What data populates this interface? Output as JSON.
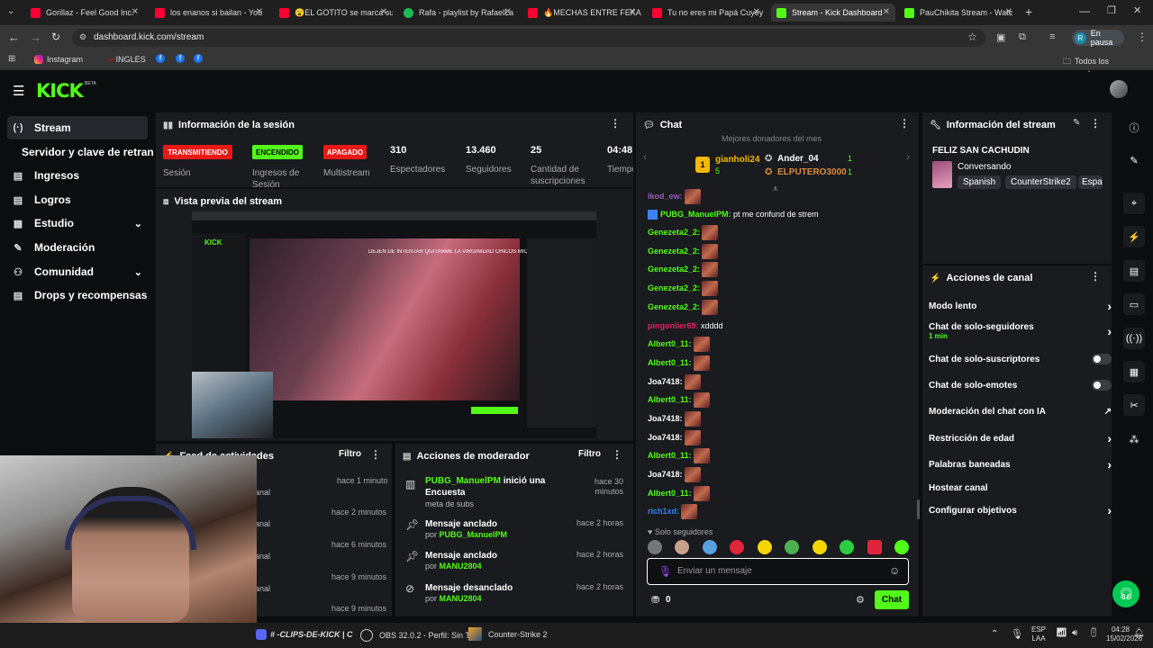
{
  "browser": {
    "tabs": [
      {
        "label": "Gorillaz - Feel Good Inc.",
        "color": "#ff0033"
      },
      {
        "label": "los enanos si bailan - You",
        "color": "#ff0033"
      },
      {
        "label": "😮EL GOTITO se marca su",
        "color": "#ff0033"
      },
      {
        "label": "Rafa - playlist by RafaelLa",
        "color": "#1db954"
      },
      {
        "label": "🔥MECHAS ENTRE FEKA (",
        "color": "#ff0033"
      },
      {
        "label": "Tu no eres mi Papá Cuyey",
        "color": "#ff0033"
      },
      {
        "label": "Stream - Kick Dashboard",
        "color": "#53fc18"
      },
      {
        "label": "PauChikita Stream - Watc",
        "color": "#53fc18"
      }
    ],
    "url": "dashboard.kick.com/stream",
    "profile_label": "En pausa",
    "profile_initial": "R",
    "bookmarks": [
      "Instagram",
      "INGLES"
    ],
    "all_bookmarks": "Todos los marcadores"
  },
  "brand": {
    "logo": "KICK",
    "beta": "BETA",
    "accent": "#53fc18"
  },
  "sidebar": {
    "items": [
      {
        "label": "Stream",
        "icon": "(·)"
      },
      {
        "label": "Servidor y clave de retransmisión",
        "icon": ""
      },
      {
        "label": "Ingresos",
        "icon": "▤"
      },
      {
        "label": "Logros",
        "icon": "▤"
      },
      {
        "label": "Estudio",
        "icon": "▦"
      },
      {
        "label": "Moderación",
        "icon": "🔧"
      },
      {
        "label": "Comunidad",
        "icon": "👥"
      },
      {
        "label": "Drops y recompensas",
        "icon": "▤"
      }
    ]
  },
  "session": {
    "title": "Información de la sesión",
    "badges": {
      "session": "TRANSMITIENDO",
      "ingress": "ENCENDIDO",
      "multistream": "APAGADO"
    },
    "labels": {
      "session": "Sesión",
      "ingress": "Ingresos de Sesión",
      "multistream": "Multistream"
    },
    "stats": [
      {
        "value": "310",
        "label": "Espectadores"
      },
      {
        "value": "13.460",
        "label": "Seguidores"
      },
      {
        "value": "25",
        "label": "Cantidad de suscripciones"
      },
      {
        "value": "04:48:",
        "label": "Tiempo en vivo"
      }
    ]
  },
  "preview": {
    "title": "Vista previa del stream",
    "overlay_text": "DEJEN DE INTENTAR QUITARME LA VIRGINIDAD CHICOS MIO"
  },
  "feed": {
    "title": "Feed de actividades",
    "filter": "Filtro",
    "times": [
      "hace 1 minuto",
      "hace 2 minutos",
      "hace 6 minutos",
      "hace 9 minutos",
      "hace 9 minutos"
    ],
    "snippets": [
      "anal",
      "anal",
      "anal",
      "anal",
      "anal"
    ]
  },
  "modactions": {
    "title": "Acciones de moderador",
    "filter": "Filtro",
    "items": [
      {
        "user": "PUBG_ManuelPM",
        "action": "inició una Encuesta",
        "sub": "meta de subs",
        "time": "hace 30 minutos"
      },
      {
        "title": "Mensaje anclado",
        "by": "por",
        "user": "PUBG_ManuelPM",
        "time": "hace 2 horas"
      },
      {
        "title": "Mensaje anclado",
        "by": "por",
        "user": "MANU2804",
        "time": "hace 2 horas"
      },
      {
        "title": "Mensaje desanclado",
        "by": "por",
        "user": "MANU2804",
        "time": "hace 2 horas"
      }
    ]
  },
  "chat": {
    "title": "Chat",
    "donors_title": "Mejores donadores del mes",
    "donors": [
      {
        "name": "gianholi24",
        "count": "5"
      },
      {
        "name": "Ander_04",
        "count": "1"
      },
      {
        "name": "ELPUTERO3000",
        "count": "1"
      }
    ],
    "messages": [
      {
        "user": "ikod_ew:",
        "text": "",
        "color": "#9b59b6"
      },
      {
        "user": "PUBG_ManuelPM:",
        "text": "pt me confund de strem",
        "color": "#53fc18"
      },
      {
        "user": "Genezeta2_2:",
        "text": "",
        "color": "#53fc18"
      },
      {
        "user": "Genezeta2_2:",
        "text": "",
        "color": "#53fc18"
      },
      {
        "user": "Genezeta2_2:",
        "text": "",
        "color": "#53fc18"
      },
      {
        "user": "Genezeta2_2:",
        "text": "",
        "color": "#53fc18"
      },
      {
        "user": "Genezeta2_2:",
        "text": "",
        "color": "#53fc18"
      },
      {
        "user": "pingonlier69:",
        "text": "xdddd",
        "color": "#e0245e"
      },
      {
        "user": "Albert0_11:",
        "text": "",
        "color": "#53fc18"
      },
      {
        "user": "Albert0_11:",
        "text": "",
        "color": "#53fc18"
      },
      {
        "user": "Joa7418:",
        "text": "",
        "color": "#ffffff"
      },
      {
        "user": "Albert0_11:",
        "text": "",
        "color": "#53fc18"
      },
      {
        "user": "Joa7418:",
        "text": "",
        "color": "#ffffff"
      },
      {
        "user": "Joa7418:",
        "text": "",
        "color": "#ffffff"
      },
      {
        "user": "Albert0_11:",
        "text": "",
        "color": "#53fc18"
      },
      {
        "user": "Joa7418:",
        "text": "",
        "color": "#ffffff"
      },
      {
        "user": "Albert0_11:",
        "text": "",
        "color": "#53fc18"
      },
      {
        "user": "rich1xd:",
        "text": "",
        "color": "#3b82f6"
      }
    ],
    "followers_only": "Solo seguidores",
    "input_placeholder": "Enviar un mensaje",
    "points": "0",
    "send": "Chat"
  },
  "streaminfo": {
    "title": "Información del stream",
    "stream_title": "FELIZ SAN CACHUDIN",
    "category": "Conversando",
    "tags": [
      "Spanish",
      "CounterStrike2",
      "Espa"
    ]
  },
  "channel_actions": {
    "title": "Acciones de canal",
    "rows": [
      {
        "label": "Modo lento",
        "sub": "",
        "control": "chevron"
      },
      {
        "label": "Chat de solo-seguidores",
        "sub": "1 min",
        "control": "chevron"
      },
      {
        "label": "Chat de solo-suscriptores",
        "sub": "",
        "control": "toggle"
      },
      {
        "label": "Chat de solo-emotes",
        "sub": "",
        "control": "toggle"
      },
      {
        "label": "Moderación del chat con IA",
        "sub": "",
        "control": "external"
      },
      {
        "label": "Restricción de edad",
        "sub": "",
        "control": "chevron"
      },
      {
        "label": "Palabras baneadas",
        "sub": "",
        "control": "chevron"
      },
      {
        "label": "Hostear canal",
        "sub": "",
        "control": "none"
      },
      {
        "label": "Configurar objetivos",
        "sub": "",
        "control": "chevron"
      }
    ]
  },
  "taskbar": {
    "items": [
      "# -CLIPS-DE-KICK | C",
      "OBS 32.0.2 - Perfil: Sin T",
      "Counter-Strike 2"
    ],
    "lang": "ESP",
    "lang2": "LAA",
    "time": "04:28",
    "date": "15/02/2026"
  }
}
